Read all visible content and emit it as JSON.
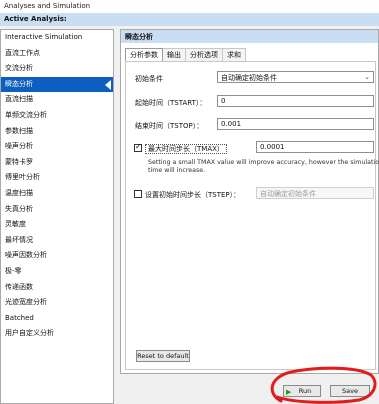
{
  "window": {
    "title": "Analyses and Simulation"
  },
  "left": {
    "header": "Active Analysis:",
    "items": [
      "Interactive Simulation",
      "直流工作点",
      "交流分析",
      "瞬态分析",
      "直流扫描",
      "单频交流分析",
      "参数扫描",
      "噪声分析",
      "蒙特卡罗",
      "傅里叶分析",
      "温度扫描",
      "失真分析",
      "灵敏度",
      "最坏情况",
      "噪声因数分析",
      "极-零",
      "传递函数",
      "光迹宽度分析",
      "Batched",
      "用户自定义分析"
    ],
    "selected_index": 3
  },
  "right": {
    "header": "瞬态分析",
    "tabs": [
      "分析参数",
      "输出",
      "分析选项",
      "求和"
    ],
    "active_tab": 0,
    "initial_conditions": {
      "label": "初始条件",
      "value": "自动确定初始条件"
    },
    "tstart": {
      "label": "起始时间（TSTART）：",
      "value": "0"
    },
    "tstop": {
      "label": "结束时间（TSTOP）：",
      "value": "0.001"
    },
    "tmax": {
      "label": "最大时间步长（TMAX）",
      "value": "0.0001",
      "checked": true
    },
    "tmax_note": "Setting a small TMAX value will improve accuracy, however the simulation time will increase.",
    "tstep": {
      "label": "设置初始时间步长（TSTEP）：",
      "value": "自动确定初始条件",
      "checked": false
    },
    "reset_label": "Reset to default"
  },
  "footer": {
    "run_label": "Run",
    "save_label": "Save"
  }
}
